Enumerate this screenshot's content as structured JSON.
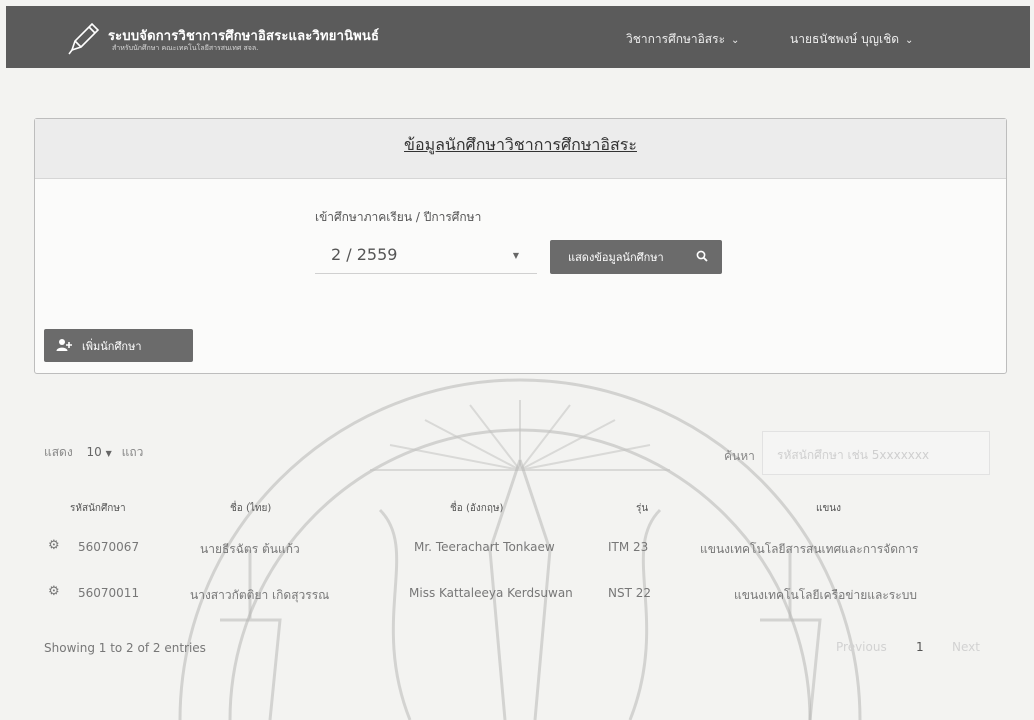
{
  "header": {
    "title": "ระบบจัดการวิชาการศึกษาอิสระและวิทยานิพนธ์",
    "subtitle": "สำหรับนักศึกษา คณะเทคโนโลยีสารสนเทศ สจล.",
    "menu": [
      {
        "label": "วิชาการศึกษาอิสระ"
      },
      {
        "label": "นายธนัชพงษ์ บุญเชิด"
      }
    ]
  },
  "panel": {
    "title": "ข้อมูลนักศึกษาวิชาการศึกษาอิสระ",
    "term_label": "เข้าศึกษาภาคเรียน / ปีการศึกษา",
    "term_value": "2 / 2559",
    "search_button": "แสดงข้อมูลนักศึกษา",
    "add_button": "เพิ่มนักศึกษา"
  },
  "table_controls": {
    "show_label": "แสดง",
    "length_value": "10",
    "rows_label": "แถว",
    "search_label": "ค้นหา",
    "search_placeholder": "รหัสนักศึกษา เช่น 5xxxxxxx"
  },
  "table": {
    "columns": [
      "รหัสนักศึกษา",
      "ชื่อ (ไทย)",
      "ชื่อ (อังกฤษ)",
      "รุ่น",
      "แขนง"
    ],
    "rows": [
      [
        "56070067",
        "นายธีรฉัตร ต้นแก้ว",
        "Mr. Teerachart Tonkaew",
        "ITM 23",
        "แขนงเทคโนโลยีสารสนเทศและการจัดการ"
      ],
      [
        "56070011",
        "นางสาวกัตติยา เกิดสุวรรณ",
        "Miss Kattaleeya Kerdsuwan",
        "NST 22",
        "แขนงเทคโนโลยีเครือข่ายและระบบ"
      ]
    ],
    "info": "Showing 1 to 2 of 2 entries",
    "pagination": {
      "previous": "Previous",
      "current": "1",
      "next": "Next"
    }
  },
  "colors": {
    "navbar": "#5b5b5b",
    "button": "#6b6b6b",
    "background": "#f3f3f1"
  },
  "icons": {
    "brand": "pencil-icon",
    "search": "search-icon",
    "add": "add-user-icon",
    "row_action": "gear-icon"
  }
}
